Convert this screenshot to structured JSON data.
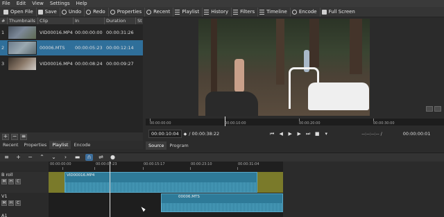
{
  "menu": [
    "File",
    "Edit",
    "View",
    "Settings",
    "Help"
  ],
  "toolbar": {
    "open_file": "Open File",
    "save": "Save",
    "undo": "Undo",
    "redo": "Redo",
    "properties": "Properties",
    "recent": "Recent",
    "playlist": "Playlist",
    "history": "History",
    "filters": "Filters",
    "timeline": "Timeline",
    "encode": "Encode",
    "full_screen": "Full Screen"
  },
  "playlist": {
    "columns": [
      "#",
      "Thumbnails",
      "Clip",
      "In",
      "Duration",
      "St"
    ],
    "rows": [
      {
        "num": "1",
        "clip": "VID00016.MP4",
        "in": "00:00:00:00",
        "duration": "00:00:31:26"
      },
      {
        "num": "2",
        "clip": "00006.MTS",
        "in": "00:00:05:23",
        "duration": "00:00:12:14"
      },
      {
        "num": "3",
        "clip": "VID00016.MP4",
        "in": "00:00:08:24",
        "duration": "00:00:09:27"
      }
    ],
    "selected_row": 1
  },
  "left_tabs": [
    "Recent",
    "Properties",
    "Playlist",
    "Encode"
  ],
  "left_tab_active": "Playlist",
  "viewer": {
    "ruler_labels": [
      "00:00:00:00",
      "00:00:10:00",
      "00:00:20:00",
      "00:00:30:00"
    ],
    "current_time": "00:00:10:04",
    "total_time": "/ 00:00:38:22",
    "in_out": "--:--:--:-- /",
    "right_time": "00:00:00:01",
    "tabs": [
      "Source",
      "Program"
    ],
    "tab_active": "Source"
  },
  "timeline": {
    "ruler_labels": [
      "00:00:00:00",
      "00:00:07:23",
      "00:00:15:17",
      "00:00:23:10",
      "00:00:31:04"
    ],
    "tracks": [
      {
        "name": "B roll",
        "buttons": [
          "M",
          "H",
          "C"
        ]
      },
      {
        "name": "V1",
        "buttons": [
          "M",
          "H",
          "C"
        ]
      },
      {
        "name": "A1",
        "buttons": []
      }
    ],
    "clips": [
      {
        "name": "VID00016.MP4",
        "track": "B roll"
      },
      {
        "name": "00006.MTS",
        "track": "V1"
      }
    ]
  },
  "colors": {
    "accent": "#2f6f9a",
    "clip": "#2e7a98",
    "gap": "#7a7a2a"
  }
}
